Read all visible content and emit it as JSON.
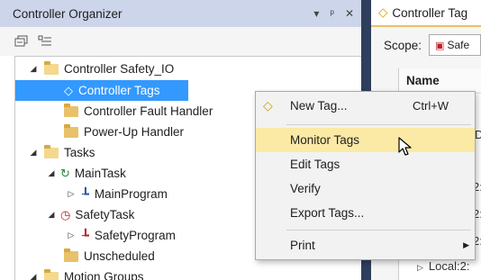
{
  "organizer": {
    "title": "Controller Organizer",
    "title_buttons": [
      "▾",
      "ᵖ",
      "✕"
    ],
    "toolbar_icons": [
      "collapse-all-icon",
      "expand-all-icon"
    ]
  },
  "tree": {
    "items": [
      {
        "label": "Controller Safety_IO",
        "icon": "folder-open-icon",
        "expander": "◢"
      },
      {
        "label": "Controller Tags",
        "icon": "tag-icon",
        "selected": true
      },
      {
        "label": "Controller Fault Handler",
        "icon": "folder-icon"
      },
      {
        "label": "Power-Up Handler",
        "icon": "folder-icon"
      },
      {
        "label": "Tasks",
        "icon": "folder-open-icon",
        "expander": "◢"
      },
      {
        "label": "MainTask",
        "icon": "continuous-task-icon",
        "expander": "◢"
      },
      {
        "label": "MainProgram",
        "icon": "program-icon",
        "expander": "▷"
      },
      {
        "label": "SafetyTask",
        "icon": "safety-task-icon",
        "expander": "◢"
      },
      {
        "label": "SafetyProgram",
        "icon": "safety-program-icon",
        "expander": "▷"
      },
      {
        "label": "Unscheduled",
        "icon": "folder-icon"
      },
      {
        "label": "Motion Groups",
        "icon": "folder-open-icon",
        "expander": "◢"
      }
    ]
  },
  "tags_pane": {
    "tab_title": "Controller Tag",
    "scope_label": "Scope:",
    "scope_value": "Safe",
    "column_header": "Name",
    "cells": [
      "D",
      "2:",
      "2:",
      "2:",
      "Local:2:"
    ]
  },
  "context_menu": {
    "items": [
      {
        "label": "New Tag...",
        "shortcut": "Ctrl+W",
        "icon": "tag-icon"
      },
      {
        "label": "Monitor Tags",
        "hovered": true
      },
      {
        "label": "Edit Tags"
      },
      {
        "label": "Verify"
      },
      {
        "label": "Export Tags..."
      },
      {
        "label": "Print",
        "submenu": true
      }
    ]
  },
  "colors": {
    "title_bar": "#ccd5e9",
    "selection": "#3399ff",
    "menu_hover": "#fbeaa5",
    "splitter": "#2f3e5c",
    "folder": "#e8c16a"
  }
}
